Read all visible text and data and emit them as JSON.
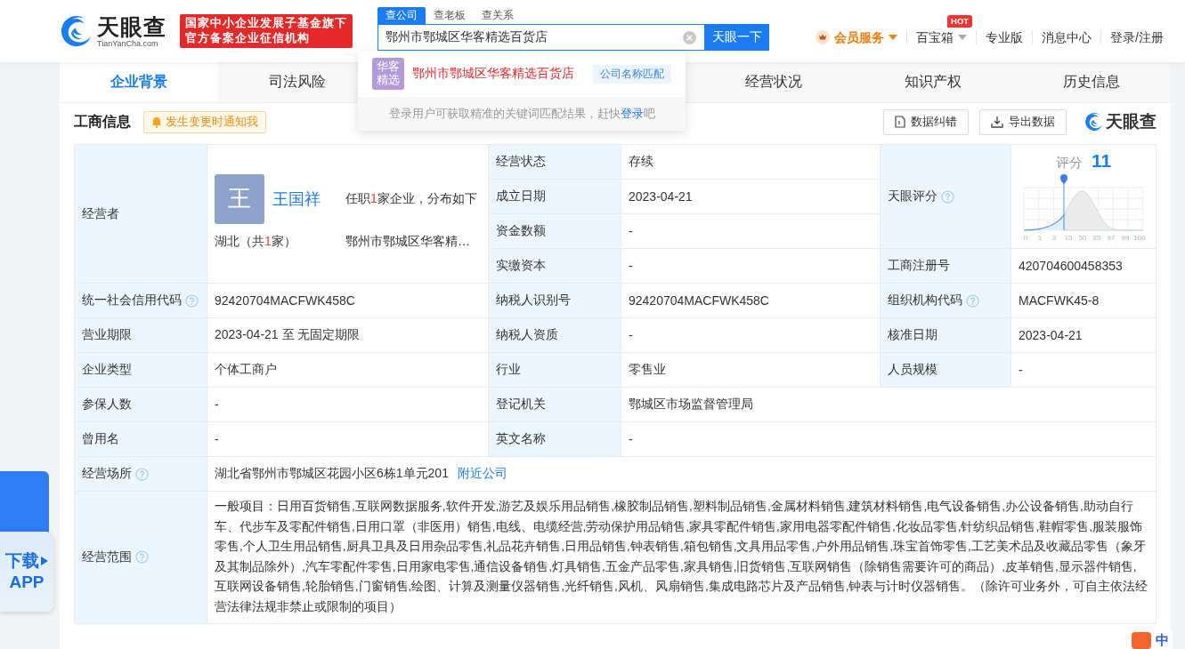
{
  "header": {
    "logo": {
      "name": "天眼查",
      "domain": "TianYanCha.com"
    },
    "slogan": [
      "国家中小企业发展子基金旗下",
      "官方备案企业征信机构"
    ],
    "search": {
      "tabs": [
        {
          "label": "查公司",
          "selected": true
        },
        {
          "label": "查老板",
          "selected": false
        },
        {
          "label": "查关系",
          "selected": false
        }
      ],
      "value": "鄂州市鄂城区华客精选百货店",
      "button": "天眼一下"
    },
    "nav": [
      {
        "label": "会员服务",
        "kind": "vip"
      },
      {
        "label": "百宝箱",
        "kind": "menu",
        "badge": "HOT"
      },
      {
        "label": "专业版",
        "kind": "link"
      },
      {
        "label": "消息中心",
        "kind": "link"
      },
      {
        "label": "登录/注册",
        "kind": "link"
      }
    ]
  },
  "suggestions": {
    "items": [
      {
        "avatar": "华客精选",
        "name": "鄂州市鄂城区华客精选百货店",
        "tag": "公司名称匹配"
      }
    ],
    "hint": {
      "before": "登录用户可获取精准的关键词匹配结果，赶快",
      "link": "登录",
      "after": "吧"
    }
  },
  "tabs": [
    {
      "label": "企业背景",
      "selected": true
    },
    {
      "label": "司法风险",
      "selected": false
    },
    {
      "label": "经营状况",
      "selected": false
    },
    {
      "label": "知识产权",
      "selected": false
    },
    {
      "label": "历史信息",
      "selected": false
    }
  ],
  "section": {
    "title": "工商信息",
    "notify": "发生变更时通知我",
    "actions": [
      {
        "label": "数据纠错",
        "kind": "correct"
      },
      {
        "label": "导出数据",
        "kind": "export"
      }
    ],
    "brand": "天眼查"
  },
  "operator": {
    "label": "经营者",
    "avatar": "王",
    "name": "王国祥",
    "positions": {
      "before": "任职",
      "count": "1",
      "after": "家企业，分布如下"
    },
    "region": {
      "before": "湖北（共",
      "count": "1",
      "after": "家）"
    },
    "company": "鄂州市鄂城区华客精…"
  },
  "top_fields": [
    {
      "label": "经营状态",
      "value": "存续"
    },
    {
      "label": "成立日期",
      "value": "2023-04-21"
    },
    {
      "label": "资金数额",
      "value": "-"
    },
    {
      "label": "实缴资本",
      "value": "-"
    }
  ],
  "score": {
    "label": "天眼评分",
    "help": true,
    "caption": "评分",
    "value": "11",
    "axis_labels": [
      "0",
      "1",
      "3",
      "15",
      "50",
      "85",
      "97",
      "99",
      "100"
    ]
  },
  "registration": {
    "label": "工商注册号",
    "value": "420704600458353"
  },
  "rows": [
    [
      {
        "label": "统一社会信用代码",
        "help": true,
        "value": "92420704MACFWK458C"
      },
      {
        "label": "纳税人识别号",
        "help": false,
        "value": "92420704MACFWK458C"
      },
      {
        "label": "组织机构代码",
        "help": true,
        "value": "MACFWK45-8"
      }
    ],
    [
      {
        "label": "营业期限",
        "help": false,
        "value": "2023-04-21 至 无固定期限"
      },
      {
        "label": "纳税人资质",
        "help": false,
        "value": "-"
      },
      {
        "label": "核准日期",
        "help": false,
        "value": "2023-04-21"
      }
    ],
    [
      {
        "label": "企业类型",
        "help": false,
        "value": "个体工商户"
      },
      {
        "label": "行业",
        "help": false,
        "value": "零售业"
      },
      {
        "label": "人员规模",
        "help": false,
        "value": "-"
      }
    ],
    [
      {
        "label": "参保人数",
        "help": false,
        "value": "-"
      },
      {
        "label": "登记机关",
        "help": false,
        "value": "鄂城区市场监督管理局"
      }
    ],
    [
      {
        "label": "曾用名",
        "help": false,
        "value": "-"
      },
      {
        "label": "英文名称",
        "help": false,
        "value": "-"
      }
    ],
    [
      {
        "label": "经营场所",
        "help": true,
        "value": "湖北省鄂州市鄂城区花园小区6栋1单元201",
        "link": "附近公司"
      }
    ],
    [
      {
        "label": "经营范围",
        "help": true,
        "value": "一般项目：日用百货销售,互联网数据服务,软件开发,游艺及娱乐用品销售,橡胶制品销售,塑料制品销售,金属材料销售,建筑材料销售,电气设备销售,办公设备销售,助动自行车、代步车及零配件销售,日用口罩（非医用）销售,电线、电缆经营,劳动保护用品销售,家具零配件销售,家用电器零配件销售,化妆品零售,针纺织品销售,鞋帽零售,服装服饰零售,个人卫生用品销售,厨具卫具及日用杂品零售,礼品花卉销售,日用品销售,钟表销售,箱包销售,文具用品零售,户外用品销售,珠宝首饰零售,工艺美术品及收藏品零售（象牙及其制品除外）,汽车零配件零售,日用家电零售,通信设备销售,灯具销售,五金产品零售,家具销售,旧货销售,互联网销售（除销售需要许可的商品）,皮革销售,显示器件销售,互联网设备销售,轮胎销售,门窗销售,绘图、计算及测量仪器销售,光纤销售,风机、风扇销售,集成电路芯片及产品销售,钟表与计时仪器销售。（除许可业务外，可自主依法经营法律法规非禁止或限制的项目）"
      }
    ]
  ],
  "app_promo": {
    "line1": "下载",
    "line2": "APP"
  },
  "ime": {
    "label": "中"
  }
}
